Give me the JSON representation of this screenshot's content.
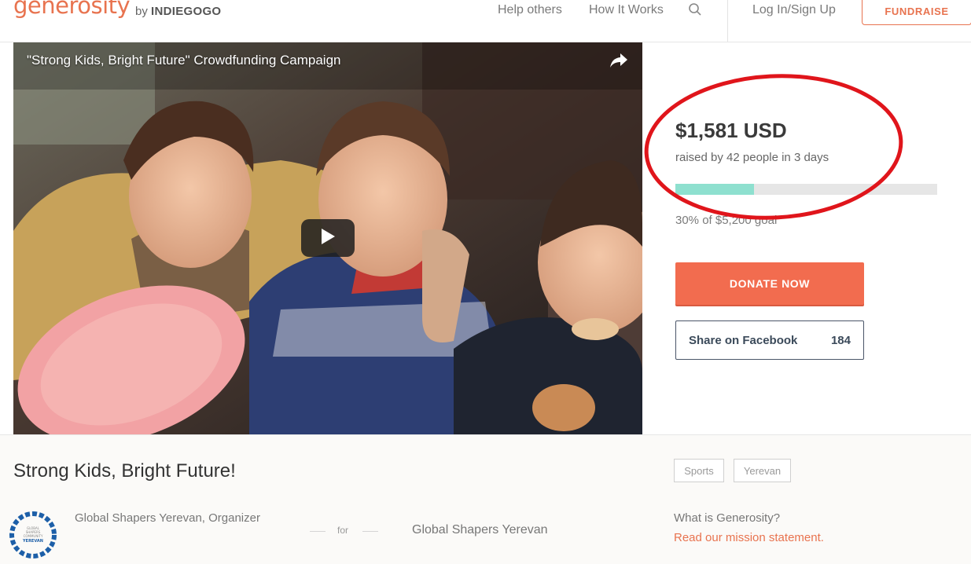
{
  "header": {
    "logo_text": "generosity",
    "logo_by": "by",
    "logo_brand": "INDIEGOGO",
    "nav": [
      "Help others",
      "How It Works"
    ],
    "search_icon": "search-icon",
    "login": "Log In/Sign Up",
    "fundraise": "FUNDRAISE",
    "accent_color": "#e8734f"
  },
  "video": {
    "title": "\"Strong Kids, Bright Future\" Crowdfunding Campaign",
    "share_icon": "share-arrow-icon",
    "play_icon": "play-icon"
  },
  "funding": {
    "amount": "$1,581 USD",
    "raised_by": "raised by 42 people in 3 days",
    "progress_fraction": 0.3,
    "progress_color": "#8ee0cf",
    "goal_text": "30% of $5,200 goal",
    "donate": "DONATE NOW",
    "donate_color": "#f26c4f",
    "share_facebook": "Share on Facebook",
    "share_count": "184",
    "annotation_color": "#e0151b"
  },
  "campaign": {
    "title": "Strong Kids, Bright Future!",
    "tags": [
      "Sports",
      "Yerevan"
    ],
    "organizer": "Global Shapers Yerevan, Organizer",
    "for_label": "for",
    "beneficiary": "Global Shapers Yerevan",
    "org_logo_lines": [
      "GLOBAL",
      "SHAPERS",
      "COMMUNITY",
      "YEREVAN"
    ],
    "what_is": "What is Generosity?",
    "mission_link": "Read our mission statement."
  }
}
